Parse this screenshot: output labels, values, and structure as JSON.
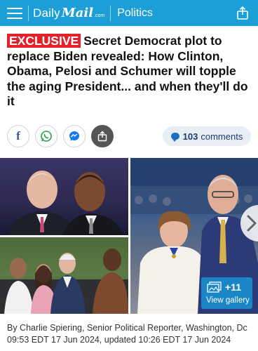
{
  "header": {
    "brand_daily": "Daily",
    "brand_mail": "Mail",
    "brand_suffix": ".com",
    "section": "Politics"
  },
  "article": {
    "badge": "EXCLUSIVE",
    "headline": "Secret Democrat plot to replace Biden revealed: How Clinton, Obama, Pelosi and Schumer will topple the aging President... and when they'll do it",
    "comments_count": "103",
    "comments_label": "comments",
    "byline": "By Charlie Spiering, Senior Political Reporter, Washington, Dc",
    "dateline": "09:53 EDT 17 Jun 2024, updated 10:26 EDT 17 Jun 2024"
  },
  "gallery": {
    "count": "+11",
    "label": "View gallery"
  },
  "share_icons": [
    "facebook-icon",
    "whatsapp-icon",
    "messenger-icon",
    "share-icon"
  ],
  "colors": {
    "header_bg": "#1b9fd6",
    "badge_bg": "#e4202a",
    "gallery_btn": "#1b86c6",
    "comments_bg": "#e9eef5"
  }
}
